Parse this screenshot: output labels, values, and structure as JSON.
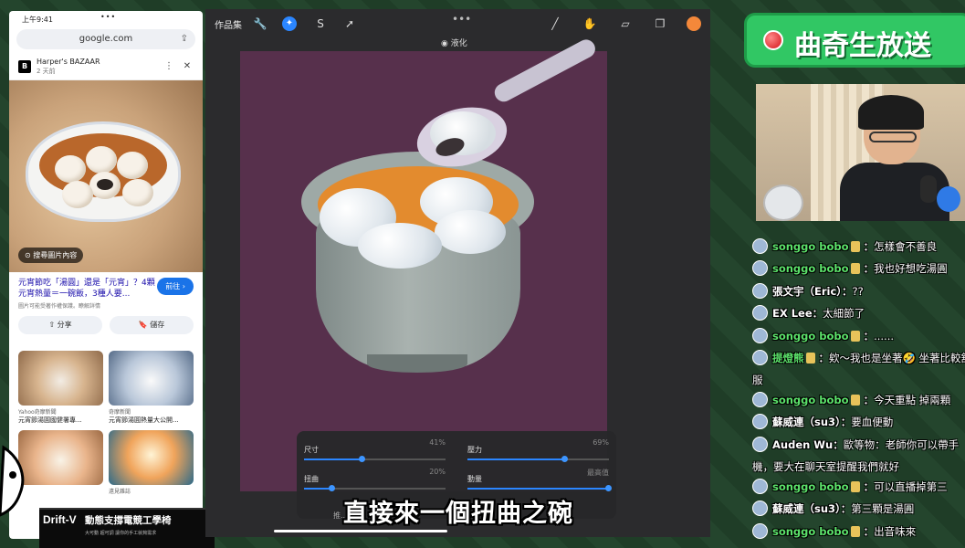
{
  "phone": {
    "time": "上午9:41",
    "status_dots": "•••",
    "url": "google.com",
    "source_name": "Harper's BAZAAR",
    "source_age": "2 天前",
    "lens_button": "搜尋圖片內容",
    "caption_title": "元宵節吃「湯圓」還是「元宵」？4顆元宵熱量＝一碗飯，3種人要...",
    "caption_sub": "圖片可能受著作權保護。瞭解詳情",
    "visit_button": "前往 ›",
    "share_button": "分享",
    "save_button": "儲存",
    "results": [
      {
        "source": "Yahoo奇摩新聞",
        "caption": "元宵節湯圓國健署專..."
      },
      {
        "source": "奇摩新聞",
        "caption": "元宵節湯圓熱量大公開..."
      },
      {
        "source": "",
        "caption": ""
      },
      {
        "source": "遠見雜誌",
        "caption": ""
      }
    ]
  },
  "ad": {
    "brand": "Drift-V",
    "title": "動態支撐電競工學椅",
    "sub": "大可動 超可調 讓你的手工就夠需求"
  },
  "procreate": {
    "gallery": "作品集",
    "mode": "液化",
    "more": "•••",
    "color_swatch": "#f4883a",
    "adjustments": [
      {
        "label": "尺寸",
        "value": "41%",
        "level": 0.41
      },
      {
        "label": "壓力",
        "value": "69%",
        "level": 0.69
      },
      {
        "label": "扭曲",
        "value": "20%",
        "level": 0.2
      },
      {
        "label": "動量",
        "value": "最高值",
        "level": 1.0
      }
    ],
    "push_label": "推..."
  },
  "subtitle": "直接來一個扭曲之碗",
  "banner": {
    "text": "曲奇生放送"
  },
  "chat": [
    {
      "name": "songgo bobo",
      "badge": true,
      "text": "怎樣會不善良",
      "green": true
    },
    {
      "name": "songgo bobo",
      "badge": true,
      "text": "我也好想吃湯圓",
      "green": true
    },
    {
      "name": "張文宇（Eric）",
      "badge": false,
      "text": "??",
      "green": false
    },
    {
      "name": "EX Lee",
      "badge": false,
      "text": "太細節了",
      "green": false
    },
    {
      "name": "songgo bobo",
      "badge": true,
      "text": "......",
      "green": true
    },
    {
      "name": "提燈熊",
      "badge": true,
      "text": "欸～我也是坐著🤣 坐著比較舒服",
      "green": true
    },
    {
      "name": "songgo bobo",
      "badge": true,
      "text": "今天重點 掉兩顆",
      "green": true
    },
    {
      "name": "蘇威連（su3）",
      "badge": false,
      "text": "要血便動",
      "green": false
    },
    {
      "name": "Auden Wu",
      "badge": false,
      "text": "歐等物：老師你可以帶手機，要大在聊天室提醒我們就好",
      "green": false
    },
    {
      "name": "songgo bobo",
      "badge": true,
      "text": "可以直播掉第三",
      "green": true
    },
    {
      "name": "蘇威連（su3）",
      "badge": false,
      "text": "第三顆是湯圓",
      "green": false
    },
    {
      "name": "songgo bobo",
      "badge": true,
      "text": "出音味來",
      "green": true
    }
  ]
}
